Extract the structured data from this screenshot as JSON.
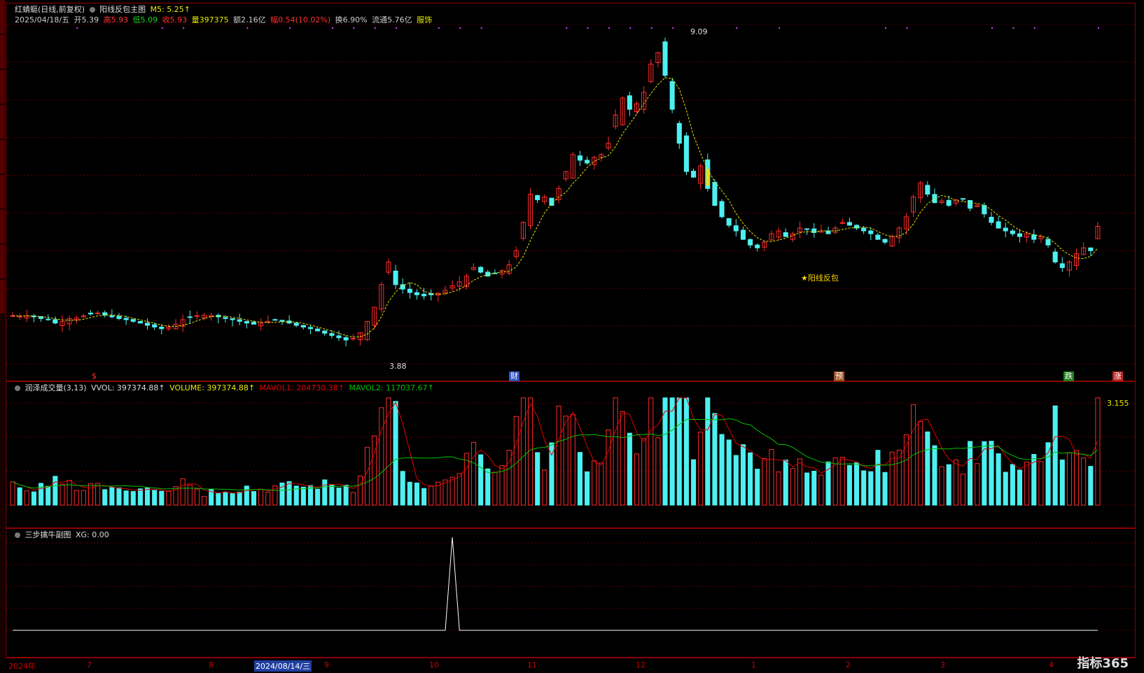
{
  "main": {
    "title": "红蜻蜓(日线,前复权)",
    "indicator": "阳线反包主图",
    "ma_label": "M5: 5.25↑",
    "date": "2025/04/18/五",
    "open": "开5.39",
    "high": "高5.93",
    "low": "低5.09",
    "close": "收5.93",
    "vol": "量397375",
    "amount": "额2.16亿",
    "change": "幅0.54(10.02%)",
    "turnover": "换6.90%",
    "float": "流通5.76亿",
    "sector": "服饰",
    "peak_label": "9.09",
    "trough_label": "3.88",
    "signal_label": "★阳线反包",
    "markers": [
      "$",
      "财",
      "预",
      "跌",
      "涨"
    ]
  },
  "volume": {
    "title": "润泽成交量(3,13)",
    "vvol": "VVOL: 397374.88↑",
    "volume": "VOLUME: 397374.88↑",
    "mavol1": "MAVOL1: 204730.38↑",
    "mavol2": "MAVOL2: 117037.67↑",
    "scale": "3.155"
  },
  "sub": {
    "title": "三步擒牛副图",
    "xg": "XG: 0.00"
  },
  "axis": {
    "labels": [
      "2024年",
      "7",
      "8",
      "2024/08/14/三",
      "9",
      "10",
      "11",
      "12",
      "1",
      "2",
      "3",
      "4"
    ]
  },
  "logo": "指标365",
  "colors": {
    "up": "#ff2a2a",
    "down": "#4df0f0",
    "ma": "#e8e800",
    "mavol1": "#e00000",
    "mavol2": "#00c000"
  },
  "chart_data": {
    "type": "candlestick",
    "close": [
      4.35,
      4.34,
      4.35,
      4.33,
      4.3,
      4.28,
      4.22,
      4.25,
      4.3,
      4.31,
      4.35,
      4.38,
      4.4,
      4.36,
      4.33,
      4.3,
      4.28,
      4.25,
      4.22,
      4.18,
      4.15,
      4.12,
      4.15,
      4.2,
      4.28,
      4.32,
      4.35,
      4.36,
      4.35,
      4.33,
      4.3,
      4.28,
      4.25,
      4.22,
      4.2,
      4.22,
      4.25,
      4.28,
      4.25,
      4.22,
      4.18,
      4.15,
      4.12,
      4.08,
      4.04,
      4.0,
      3.96,
      3.92,
      3.95,
      4.05,
      4.25,
      4.5,
      4.9,
      5.3,
      4.9,
      4.82,
      4.76,
      4.72,
      4.7,
      4.72,
      4.75,
      4.8,
      4.88,
      4.95,
      5.05,
      5.2,
      5.12,
      5.05,
      5.1,
      5.15,
      5.25,
      5.5,
      6.0,
      6.5,
      6.4,
      6.45,
      6.3,
      6.6,
      6.9,
      7.2,
      7.1,
      7.05,
      7.15,
      7.2,
      7.4,
      7.9,
      8.2,
      8.0,
      8.1,
      8.3,
      8.8,
      9.0,
      8.6,
      8.0,
      7.4,
      6.9,
      6.8,
      7.0,
      6.6,
      6.3,
      6.1,
      5.95,
      5.85,
      5.7,
      5.6,
      5.55,
      5.65,
      5.8,
      5.85,
      5.75,
      5.8,
      5.9,
      5.88,
      5.82,
      5.85,
      5.8,
      5.9,
      6.0,
      5.95,
      5.9,
      5.85,
      5.8,
      5.7,
      5.65,
      5.75,
      5.9,
      6.1,
      6.45,
      6.7,
      6.5,
      6.35,
      6.38,
      6.3,
      6.4,
      6.42,
      6.25,
      6.3,
      6.15,
      6.0,
      5.9,
      5.85,
      5.8,
      5.75,
      5.8,
      5.7,
      5.75,
      5.6,
      5.3,
      5.2,
      5.3,
      5.45,
      5.55,
      5.5,
      5.93
    ],
    "ylim": [
      3.5,
      9.5
    ],
    "peak": 9.09,
    "trough": 3.88,
    "ma_name": "M5",
    "ma_last": 5.25,
    "volume_last": 397374.88,
    "mavol1_last": 204730.38,
    "mavol2_last": 117037.67,
    "xg_last": 0.0,
    "xg_spike_index": 62,
    "signal_index": 98
  }
}
